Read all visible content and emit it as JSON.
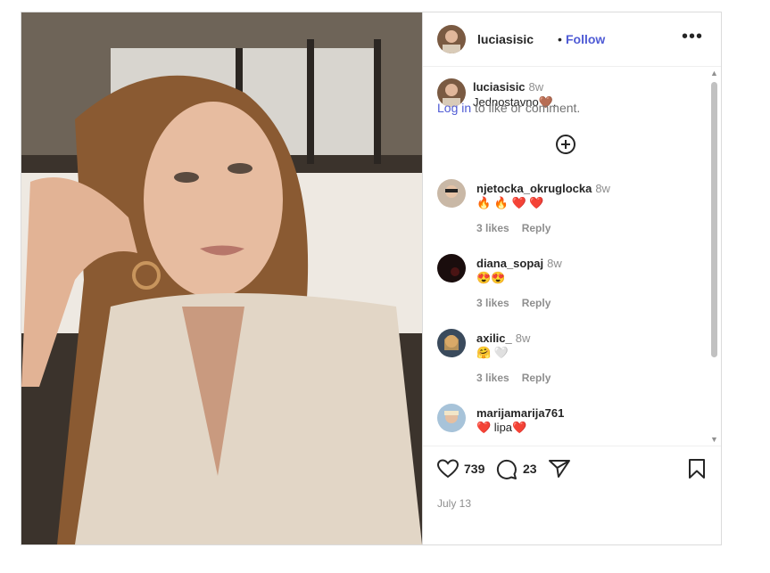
{
  "post": {
    "username": "luciasisic",
    "follow_label": "Follow",
    "dot": "•",
    "more": "•••"
  },
  "caption": {
    "username": "luciasisic",
    "time": "8w",
    "text": "Jednostavno🤎."
  },
  "comments": [
    {
      "username": "njetocka_okruglocka",
      "time": "8w",
      "text": "🔥 🔥 ❤️ ❤️",
      "likes": "3 likes",
      "reply": "Reply"
    },
    {
      "username": "diana_sopaj",
      "time": "8w",
      "text": "😍😍",
      "likes": "3 likes",
      "reply": "Reply"
    },
    {
      "username": "axilic_",
      "time": "8w",
      "text": "🤗 🤍",
      "likes": "3 likes",
      "reply": "Reply"
    },
    {
      "username": "marijamarija761",
      "time": "8w",
      "text": "❤️ lipa❤️"
    }
  ],
  "actions": {
    "likes_count": "739",
    "comments_count": "23",
    "date": "July 13"
  },
  "login": {
    "link": "Log in",
    "rest": " to like or comment."
  },
  "colors": {
    "accent": "#4f5bd5",
    "text": "#262626",
    "muted": "#8e8e8e"
  },
  "icons": [
    "heart-icon",
    "comment-icon",
    "share-icon",
    "bookmark-icon",
    "add-comment-icon",
    "more-options-icon"
  ]
}
